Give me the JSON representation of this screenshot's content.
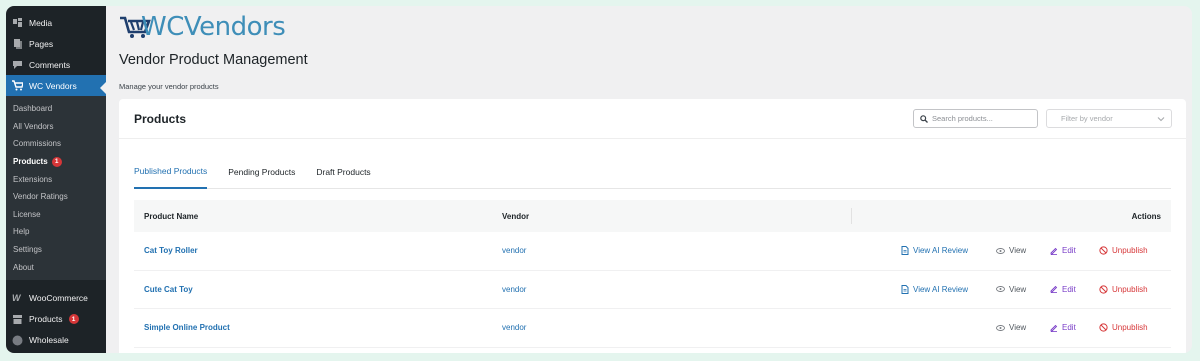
{
  "sidebar": {
    "top_items": [
      {
        "label": "Media",
        "icon": "media-icon"
      },
      {
        "label": "Pages",
        "icon": "pages-icon"
      },
      {
        "label": "Comments",
        "icon": "comments-icon"
      }
    ],
    "active_item": {
      "label": "WC Vendors",
      "icon": "cart-icon"
    },
    "sub_items": [
      {
        "label": "Dashboard"
      },
      {
        "label": "All Vendors"
      },
      {
        "label": "Commissions"
      },
      {
        "label": "Products",
        "badge": "1",
        "current": true
      },
      {
        "label": "Extensions"
      },
      {
        "label": "Vendor Ratings"
      },
      {
        "label": "License"
      },
      {
        "label": "Help"
      },
      {
        "label": "Settings"
      },
      {
        "label": "About"
      }
    ],
    "bottom_items": [
      {
        "label": "WooCommerce",
        "icon": "woocommerce-icon"
      },
      {
        "label": "Products",
        "icon": "archive-icon",
        "badge": "1"
      },
      {
        "label": "Wholesale",
        "icon": "wholesale-icon"
      }
    ]
  },
  "header": {
    "logo_text": "WCVendors",
    "title": "Vendor Product Management",
    "description": "Manage your vendor products"
  },
  "card": {
    "title": "Products",
    "search_placeholder": "Search products...",
    "filter_placeholder": "Filter by vendor",
    "tabs": [
      {
        "label": "Published Products",
        "active": true
      },
      {
        "label": "Pending Products"
      },
      {
        "label": "Draft Products"
      }
    ],
    "table": {
      "headers": {
        "name": "Product Name",
        "vendor": "Vendor",
        "actions": "Actions"
      },
      "rows": [
        {
          "name": "Cat Toy Roller",
          "vendor": "vendor",
          "ai_review": "View AI Review",
          "view": "View",
          "edit": "Edit",
          "unpublish": "Unpublish"
        },
        {
          "name": "Cute Cat Toy",
          "vendor": "vendor",
          "ai_review": "View AI Review",
          "view": "View",
          "edit": "Edit",
          "unpublish": "Unpublish"
        },
        {
          "name": "Simple Online Product",
          "vendor": "vendor",
          "view": "View",
          "edit": "Edit",
          "unpublish": "Unpublish"
        }
      ]
    }
  },
  "colors": {
    "sidebar_bg": "#1d2327",
    "active": "#2271b1",
    "badge": "#d63638",
    "edit": "#7a3ec8",
    "logo": "#3e8eb8"
  }
}
